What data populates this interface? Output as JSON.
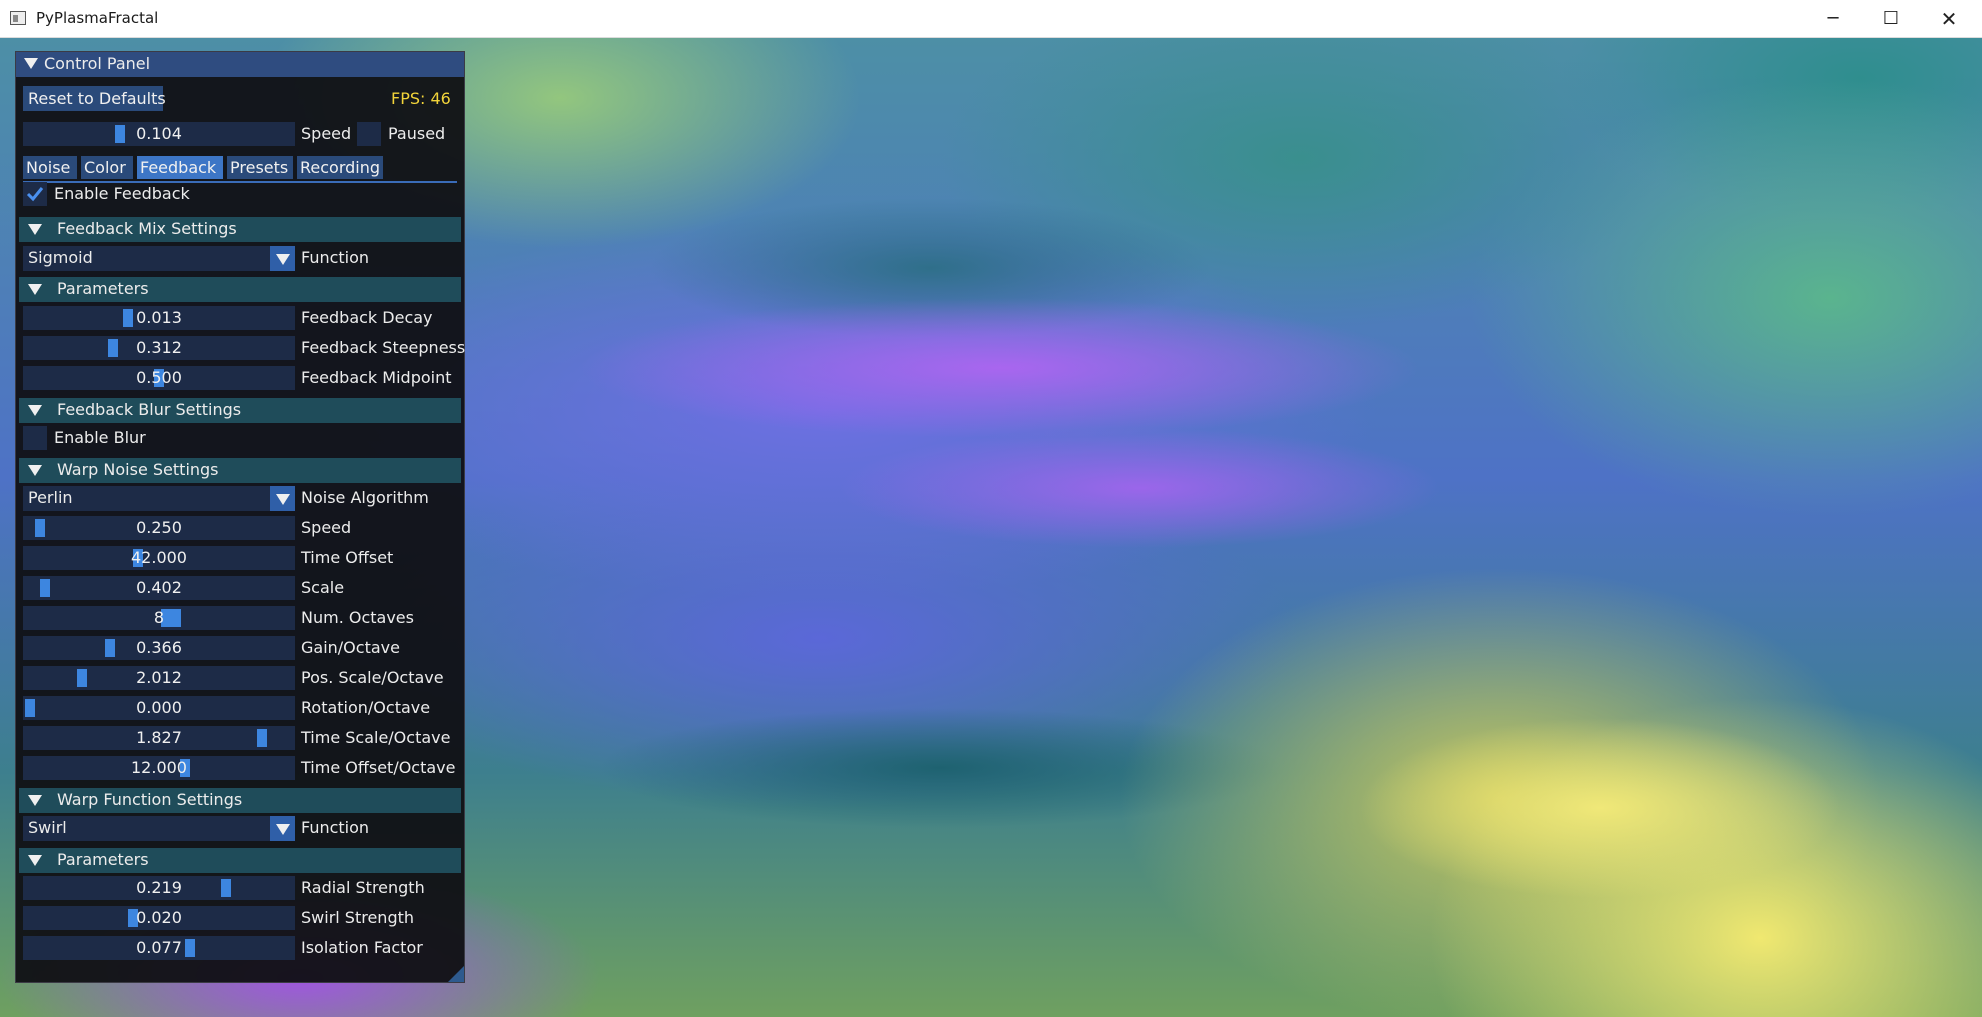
{
  "window": {
    "title": "PyPlasmaFractal",
    "minimize": "─",
    "maximize": "☐",
    "close": "✕"
  },
  "panel": {
    "title": "Control Panel",
    "reset_label": "Reset to Defaults",
    "fps": "FPS: 46",
    "speed": {
      "value": "0.104",
      "label": "Speed",
      "fraction": 0.35
    },
    "paused_label": "Paused",
    "tabs": [
      "Noise",
      "Color",
      "Feedback",
      "Presets",
      "Recording"
    ],
    "active_tab": "Feedback",
    "enable_feedback_label": "Enable Feedback",
    "feedback_mix": {
      "title": "Feedback Mix Settings",
      "function_value": "Sigmoid",
      "function_label": "Function",
      "params_title": "Parameters",
      "params": [
        {
          "value": "0.013",
          "label": "Feedback Decay",
          "fraction": 0.38
        },
        {
          "value": "0.312",
          "label": "Feedback Steepness",
          "fraction": 0.32
        },
        {
          "value": "0.500",
          "label": "Feedback Midpoint",
          "fraction": 0.5
        }
      ]
    },
    "feedback_blur": {
      "title": "Feedback Blur Settings",
      "enable_label": "Enable Blur"
    },
    "warp_noise": {
      "title": "Warp Noise Settings",
      "algorithm_value": "Perlin",
      "algorithm_label": "Noise Algorithm",
      "params": [
        {
          "value": "0.250",
          "label": "Speed",
          "fraction": 0.04
        },
        {
          "value": "42.000",
          "label": "Time Offset",
          "fraction": 0.42
        },
        {
          "value": "0.402",
          "label": "Scale",
          "fraction": 0.06
        },
        {
          "value": "8",
          "label": "Num. Octaves",
          "fraction": 0.55
        },
        {
          "value": "0.366",
          "label": "Gain/Octave",
          "fraction": 0.31
        },
        {
          "value": "2.012",
          "label": "Pos. Scale/Octave",
          "fraction": 0.2
        },
        {
          "value": "0.000",
          "label": "Rotation/Octave",
          "fraction": 0.0
        },
        {
          "value": "1.827",
          "label": "Time Scale/Octave",
          "fraction": 0.9
        },
        {
          "value": "12.000",
          "label": "Time Offset/Octave",
          "fraction": 0.6
        }
      ]
    },
    "warp_function": {
      "title": "Warp Function Settings",
      "function_value": "Swirl",
      "function_label": "Function",
      "params_title": "Parameters",
      "params": [
        {
          "value": "0.219",
          "label": "Radial Strength",
          "fraction": 0.76
        },
        {
          "value": "0.020",
          "label": "Swirl Strength",
          "fraction": 0.4
        },
        {
          "value": "0.077",
          "label": "Isolation Factor",
          "fraction": 0.62
        }
      ]
    }
  },
  "colors": {
    "title_bar": "#2f4c80",
    "section_header": "#1f4c5a",
    "slider_bg": "#1d2b47",
    "grab": "#3d86e0",
    "fps": "#f2d43a"
  }
}
